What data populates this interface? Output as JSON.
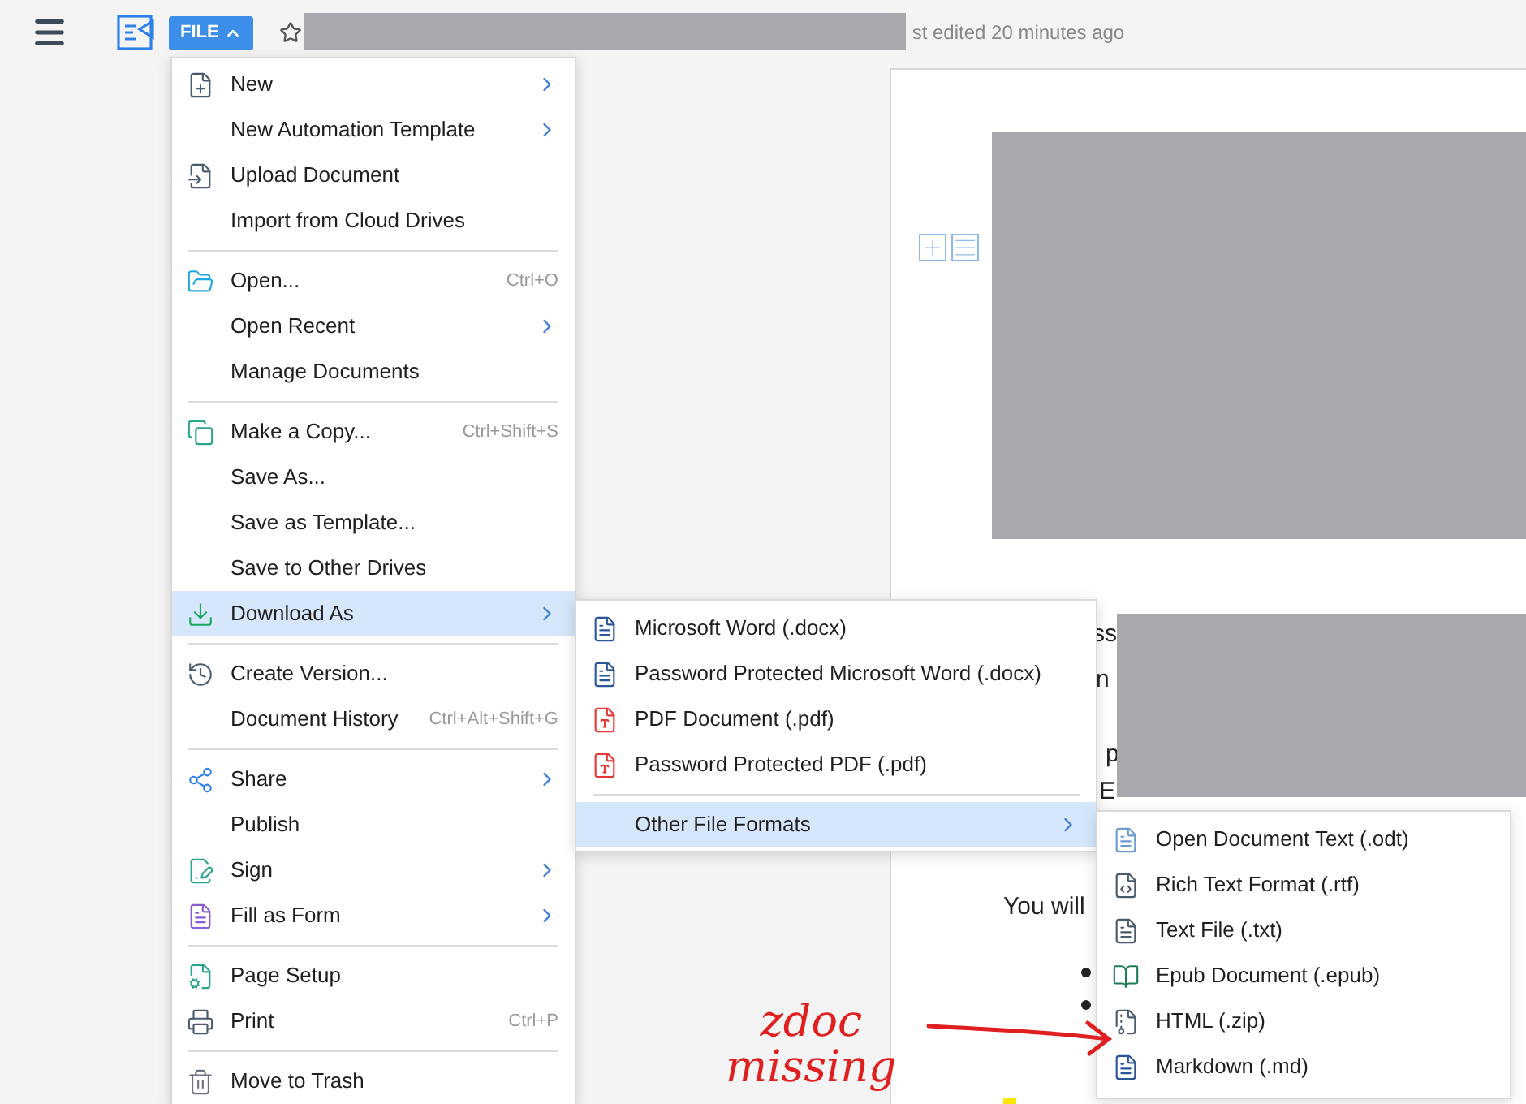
{
  "toolbar": {
    "file_button": "FILE",
    "status": "st edited 20 minutes ago"
  },
  "file_menu": {
    "items": [
      {
        "kind": "item",
        "label": "New",
        "submenu": true,
        "selected": false
      },
      {
        "kind": "item",
        "label": "New Automation Template",
        "submenu": true,
        "selected": false
      },
      {
        "kind": "item",
        "label": "Upload Document",
        "submenu": false,
        "selected": false
      },
      {
        "kind": "item",
        "label": "Import from Cloud Drives",
        "submenu": false,
        "selected": false
      },
      {
        "kind": "separator"
      },
      {
        "kind": "item",
        "label": "Open...",
        "shortcut": "Ctrl+O",
        "submenu": false,
        "selected": false
      },
      {
        "kind": "item",
        "label": "Open Recent",
        "submenu": true,
        "selected": false
      },
      {
        "kind": "item",
        "label": "Manage Documents",
        "submenu": false,
        "selected": false
      },
      {
        "kind": "separator"
      },
      {
        "kind": "item",
        "label": "Make a Copy...",
        "shortcut": "Ctrl+Shift+S",
        "submenu": false,
        "selected": false
      },
      {
        "kind": "item",
        "label": "Save As...",
        "submenu": false,
        "selected": false
      },
      {
        "kind": "item",
        "label": "Save as Template...",
        "submenu": false,
        "selected": false
      },
      {
        "kind": "item",
        "label": "Save to Other Drives",
        "submenu": false,
        "selected": false
      },
      {
        "kind": "item",
        "label": "Download As",
        "submenu": true,
        "selected": true
      },
      {
        "kind": "separator"
      },
      {
        "kind": "item",
        "label": "Create Version...",
        "submenu": false,
        "selected": false
      },
      {
        "kind": "item",
        "label": "Document History",
        "shortcut": "Ctrl+Alt+Shift+G",
        "submenu": false,
        "selected": false
      },
      {
        "kind": "separator"
      },
      {
        "kind": "item",
        "label": "Share",
        "submenu": true,
        "selected": false
      },
      {
        "kind": "item",
        "label": "Publish",
        "submenu": false,
        "selected": false
      },
      {
        "kind": "item",
        "label": "Sign",
        "submenu": true,
        "selected": false
      },
      {
        "kind": "item",
        "label": "Fill as Form",
        "submenu": true,
        "selected": false
      },
      {
        "kind": "separator"
      },
      {
        "kind": "item",
        "label": "Page Setup",
        "submenu": false,
        "selected": false
      },
      {
        "kind": "item",
        "label": "Print",
        "shortcut": "Ctrl+P",
        "submenu": false,
        "selected": false
      },
      {
        "kind": "separator"
      },
      {
        "kind": "item",
        "label": "Move to Trash",
        "submenu": false,
        "selected": false
      }
    ]
  },
  "download_menu": {
    "items": [
      {
        "kind": "item",
        "label": "Microsoft Word (.docx)",
        "submenu": false,
        "selected": false
      },
      {
        "kind": "item",
        "label": "Password Protected Microsoft Word (.docx)",
        "submenu": false,
        "selected": false
      },
      {
        "kind": "item",
        "label": "PDF Document (.pdf)",
        "submenu": false,
        "selected": false
      },
      {
        "kind": "item",
        "label": "Password Protected PDF (.pdf)",
        "submenu": false,
        "selected": false
      },
      {
        "kind": "separator"
      },
      {
        "kind": "item",
        "label": "Other File Formats",
        "submenu": true,
        "selected": true
      }
    ]
  },
  "formats_menu": {
    "items": [
      {
        "kind": "item",
        "label": "Open Document Text (.odt)",
        "submenu": false,
        "selected": false
      },
      {
        "kind": "item",
        "label": "Rich Text Format (.rtf)",
        "submenu": false,
        "selected": false
      },
      {
        "kind": "item",
        "label": "Text File (.txt)",
        "submenu": false,
        "selected": false
      },
      {
        "kind": "item",
        "label": "Epub Document (.epub)",
        "submenu": false,
        "selected": false
      },
      {
        "kind": "item",
        "label": "HTML (.zip)",
        "submenu": false,
        "selected": false
      },
      {
        "kind": "item",
        "label": "Markdown (.md)",
        "submenu": false,
        "selected": false
      }
    ]
  },
  "document": {
    "fragments": [
      "ss",
      "n",
      "p",
      "E",
      "You will"
    ]
  },
  "annotation": {
    "lines": [
      "zdoc",
      "missing"
    ]
  }
}
